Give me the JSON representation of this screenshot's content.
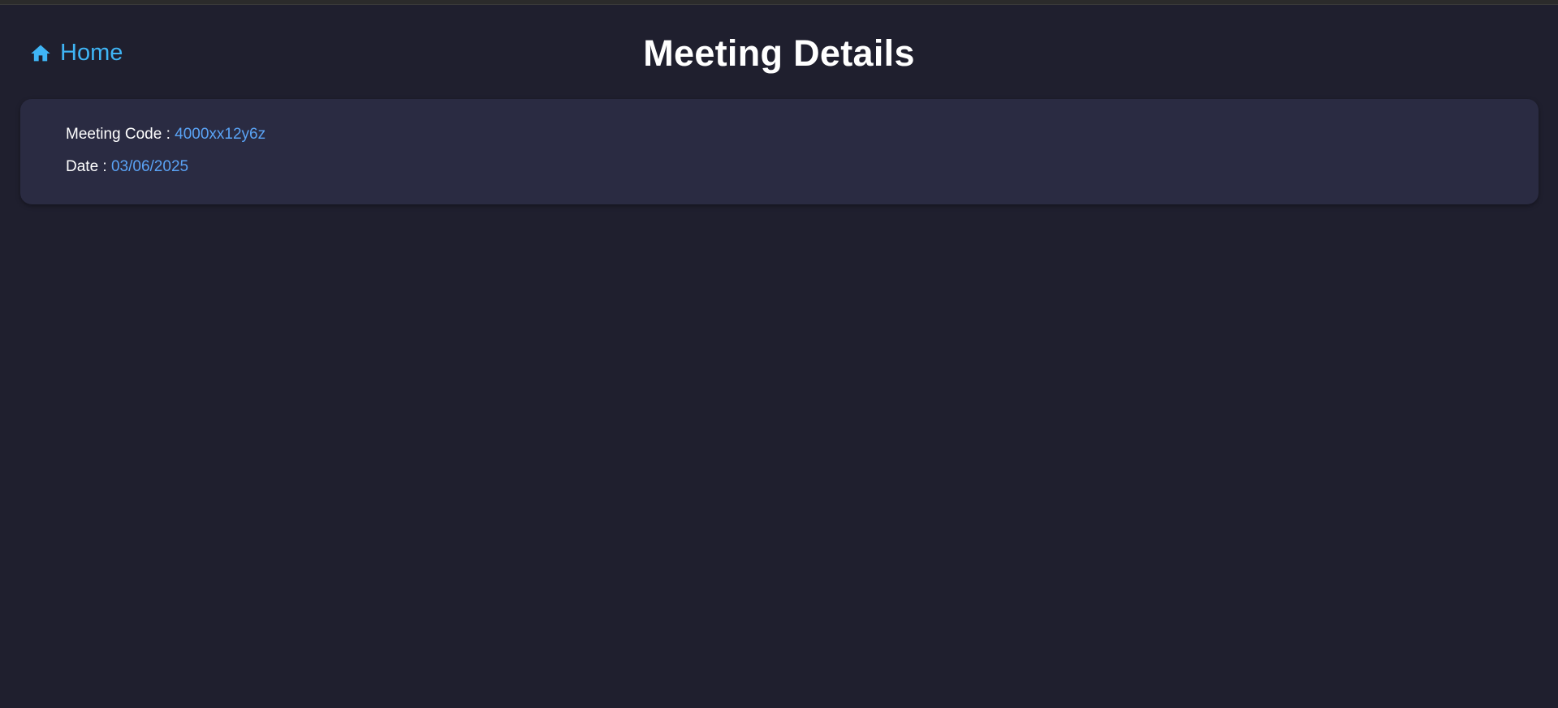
{
  "nav": {
    "home_label": "Home",
    "home_icon": "home-icon"
  },
  "header": {
    "title": "Meeting Details"
  },
  "details": {
    "code_label": "Meeting Code : ",
    "code_value": "4000xx12y6z",
    "date_label": "Date : ",
    "date_value": "03/06/2025"
  },
  "colors": {
    "background": "#1f1f2e",
    "card": "#2a2b42",
    "link": "#3fb5f5",
    "value": "#5aa3f5",
    "text": "#ffffff"
  }
}
